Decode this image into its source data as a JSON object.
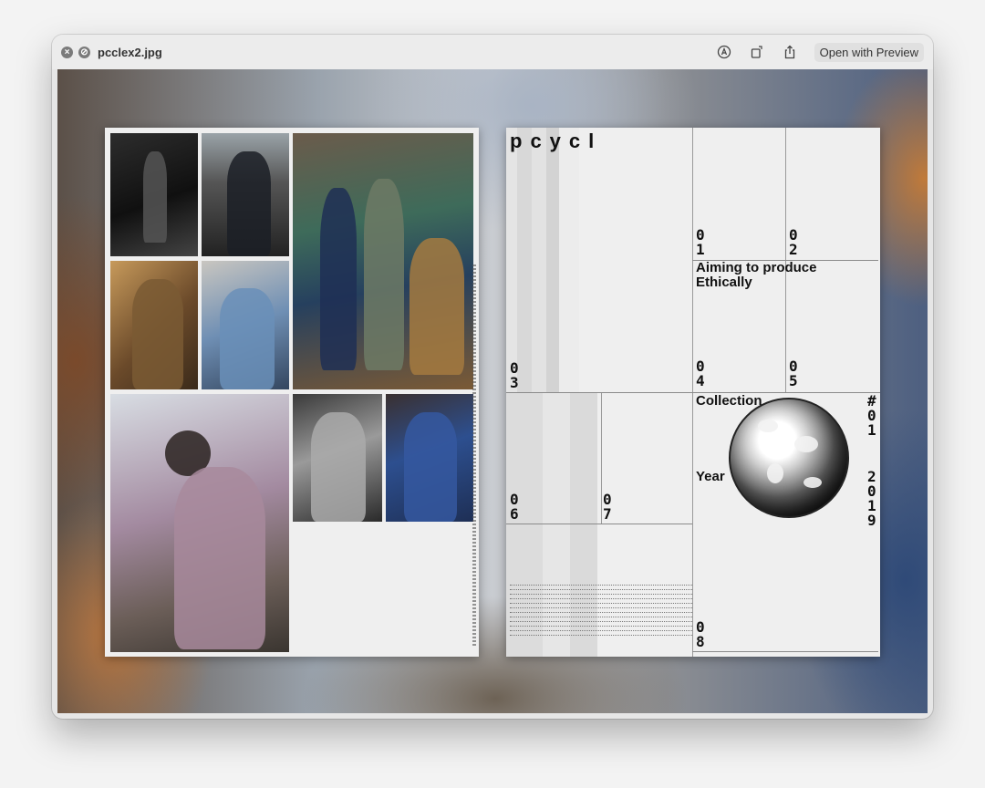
{
  "window": {
    "title": "pcclex2.jpg",
    "open_with": "Open with Preview",
    "icons": [
      "close-icon",
      "hide-icon",
      "markup-icon",
      "rotate-icon",
      "share-icon"
    ]
  },
  "image": {
    "right_page": {
      "logo": "pcycl",
      "numbers": {
        "n01": "0\n1",
        "n02": "0\n2",
        "n03": "0\n3",
        "n04": "0\n4",
        "n05": "0\n5",
        "n06": "0\n6",
        "n07": "0\n7",
        "n08": "0\n8",
        "collection_no": "#\n0\n1",
        "year_value": "2\n0\n1\n9"
      },
      "aiming": "Aiming to produce Ethically",
      "collection_label": "Collection",
      "year_label": "Year"
    }
  }
}
